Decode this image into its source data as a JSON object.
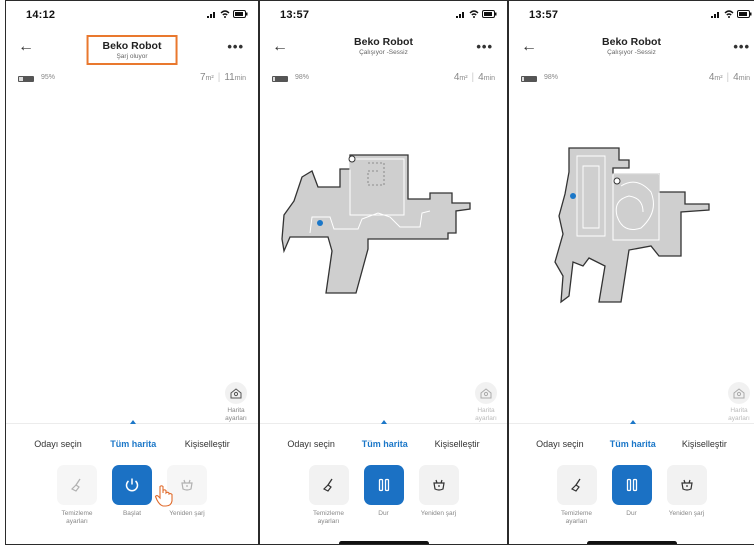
{
  "colors": {
    "accent": "#1b77c8",
    "highlight": "#e9782e",
    "map_fill": "#cfcfcf",
    "robot_dot": "#1b77c8"
  },
  "screens": [
    {
      "status": {
        "time": "14:12"
      },
      "header": {
        "title": "Beko Robot",
        "subtitle": "Şarj oluyor",
        "highlighted": true
      },
      "battery": {
        "percent_label": "95%",
        "level": 0.95
      },
      "stats": {
        "area": "7",
        "area_unit": "m²",
        "time": "11",
        "time_unit": "min"
      },
      "map_visible": false,
      "map_settings": {
        "label": "Harita\nayarları",
        "icon": "map-settings-icon"
      },
      "tabs": [
        "Odayı seçin",
        "Tüm harita",
        "Kişiselleştir"
      ],
      "active_tab": 1,
      "actions": [
        {
          "label": "Temizleme\nayarları",
          "icon": "broom-icon",
          "state": "disabled"
        },
        {
          "label": "Başlat",
          "icon": "power-icon",
          "state": "primary"
        },
        {
          "label": "Yeniden şarj",
          "icon": "dock-icon",
          "state": "disabled"
        }
      ]
    },
    {
      "status": {
        "time": "13:57"
      },
      "header": {
        "title": "Beko Robot",
        "subtitle": "Çalışıyor -Sessiz",
        "highlighted": false
      },
      "battery": {
        "percent_label": "98%",
        "level": 0.98
      },
      "stats": {
        "area": "4",
        "area_unit": "m²",
        "time": "4",
        "time_unit": "min"
      },
      "map_visible": true,
      "map_settings": {
        "label": "Harita\nayarları",
        "icon": "map-settings-icon"
      },
      "tabs": [
        "Odayı seçin",
        "Tüm harita",
        "Kişiselleştir"
      ],
      "active_tab": 1,
      "actions": [
        {
          "label": "Temizleme\nayarları",
          "icon": "broom-icon",
          "state": "normal"
        },
        {
          "label": "Dur",
          "icon": "pause-icon",
          "state": "primary"
        },
        {
          "label": "Yeniden şarj",
          "icon": "dock-icon",
          "state": "normal"
        }
      ]
    },
    {
      "status": {
        "time": "13:57"
      },
      "header": {
        "title": "Beko Robot",
        "subtitle": "Çalışıyor -Sessiz",
        "highlighted": false
      },
      "battery": {
        "percent_label": "98%",
        "level": 0.98
      },
      "stats": {
        "area": "4",
        "area_unit": "m²",
        "time": "4",
        "time_unit": "min"
      },
      "map_visible": true,
      "map_settings": {
        "label": "Harita\nayarları",
        "icon": "map-settings-icon"
      },
      "tabs": [
        "Odayı seçin",
        "Tüm harita",
        "Kişiselleştir"
      ],
      "active_tab": 1,
      "actions": [
        {
          "label": "Temizleme\nayarları",
          "icon": "broom-icon",
          "state": "normal"
        },
        {
          "label": "Dur",
          "icon": "pause-icon",
          "state": "primary"
        },
        {
          "label": "Yeniden şarj",
          "icon": "dock-icon",
          "state": "normal"
        }
      ]
    }
  ]
}
